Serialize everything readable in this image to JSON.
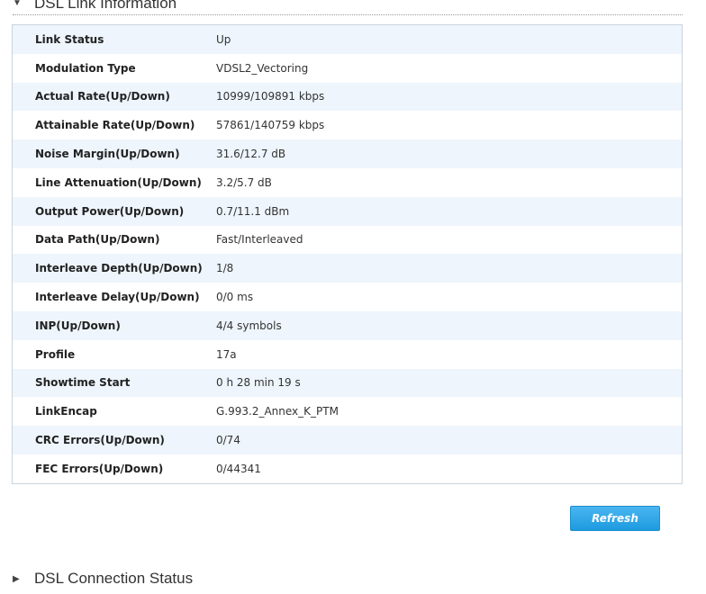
{
  "sections": {
    "link_info": {
      "title": "DSL Link Information",
      "arrow": "▼"
    },
    "connection_status": {
      "title": "DSL Connection Status",
      "arrow": "▶"
    }
  },
  "rows": [
    {
      "label": "Link Status",
      "value": "Up"
    },
    {
      "label": "Modulation Type",
      "value": "VDSL2_Vectoring"
    },
    {
      "label": "Actual Rate(Up/Down)",
      "value": "10999/109891 kbps"
    },
    {
      "label": "Attainable Rate(Up/Down)",
      "value": "57861/140759 kbps"
    },
    {
      "label": "Noise Margin(Up/Down)",
      "value": "31.6/12.7 dB"
    },
    {
      "label": "Line Attenuation(Up/Down)",
      "value": "3.2/5.7 dB"
    },
    {
      "label": "Output Power(Up/Down)",
      "value": "0.7/11.1 dBm"
    },
    {
      "label": "Data Path(Up/Down)",
      "value": "Fast/Interleaved"
    },
    {
      "label": "Interleave Depth(Up/Down)",
      "value": "1/8"
    },
    {
      "label": "Interleave Delay(Up/Down)",
      "value": "0/0 ms"
    },
    {
      "label": "INP(Up/Down)",
      "value": "4/4 symbols"
    },
    {
      "label": "Profile",
      "value": "17a"
    },
    {
      "label": "Showtime Start",
      "value": "0 h 28 min 19 s"
    },
    {
      "label": "LinkEncap",
      "value": "G.993.2_Annex_K_PTM"
    },
    {
      "label": "CRC Errors(Up/Down)",
      "value": "0/74"
    },
    {
      "label": "FEC Errors(Up/Down)",
      "value": "0/44341"
    }
  ],
  "actions": {
    "refresh_label": "Refresh"
  },
  "colors": {
    "row_stripe": "#eef5fc",
    "button": "#1d9ae0",
    "border": "#c9d3dc"
  }
}
